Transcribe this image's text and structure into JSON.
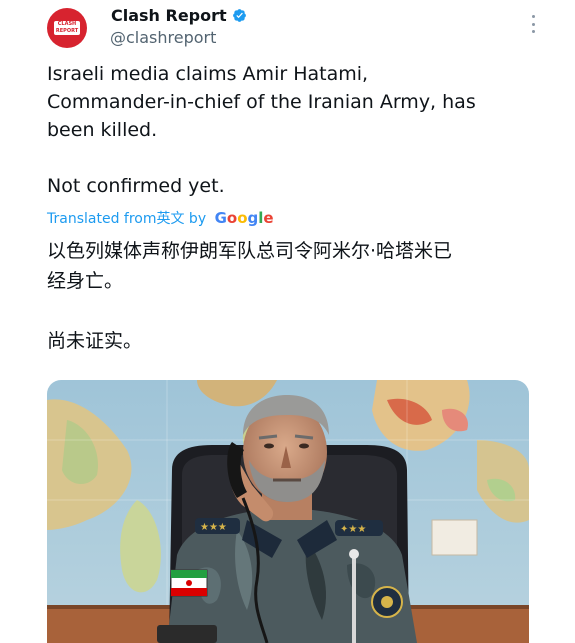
{
  "author": {
    "name": "Clash Report",
    "handle": "@clashreport",
    "avatar_text": "CLASH REPORT"
  },
  "tweet": {
    "text": "Israeli media claims Amir Hatami,\nCommander-in-chief of the Iranian Army, has\nbeen killed.\n\nNot confirmed yet."
  },
  "translation": {
    "label_prefix": "Translated from ",
    "source_language": "英文",
    "label_by": " by ",
    "provider": "Google",
    "text": "以色列媒体声称伊朗军队总司令阿米尔·哈塔米已\n经身亡。\n\n尚未证实。"
  },
  "media": {
    "type": "photo"
  },
  "colors": {
    "brand": "#d7232f",
    "link": "#1d9bf0",
    "verified": "#1d9bf0",
    "secondary_text": "#536471"
  },
  "icons": {
    "verified": "verified-badge-icon",
    "more": "more-options-icon"
  }
}
